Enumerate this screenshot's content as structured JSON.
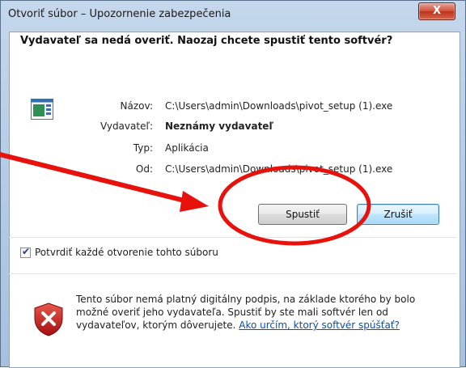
{
  "window": {
    "title": "Otvoriť súbor – Upozornenie zabezpečenia",
    "close_glyph": "X"
  },
  "dialog": {
    "headline": "Vydavateľ sa nedá overiť. Naozaj chcete spustiť tento softvér?",
    "properties": [
      {
        "label": "Názov:",
        "value": "C:\\Users\\admin\\Downloads\\pivot_setup (1).exe",
        "bold": false
      },
      {
        "label": "Vydavateľ:",
        "value": "Neznámy vydavateľ",
        "bold": true
      },
      {
        "label": "Typ:",
        "value": "Aplikácia",
        "bold": false
      },
      {
        "label": "Od:",
        "value": "C:\\Users\\admin\\Downloads\\pivot_setup (1).exe",
        "bold": false
      }
    ],
    "buttons": {
      "run": "Spustiť",
      "cancel": "Zrušiť"
    },
    "checkbox": {
      "label": "Potvrdiť každé otvorenie tohto súboru",
      "checked": true
    },
    "warning": {
      "text": "Tento súbor nemá platný digitálny podpis, na základe ktorého by bolo možné overiť jeho vydavateľa. Spustiť by ste mali softvér len od vydavateľov, ktorým dôverujete. ",
      "link": "Ako určím, ktorý softvér spúšťať?"
    }
  },
  "icons": {
    "app": "application-icon",
    "warning": "security-warning-shield-icon"
  },
  "colors": {
    "annotation_red": "#e8120c",
    "link_blue": "#0b4ea8",
    "shield_red": "#c8201c"
  }
}
